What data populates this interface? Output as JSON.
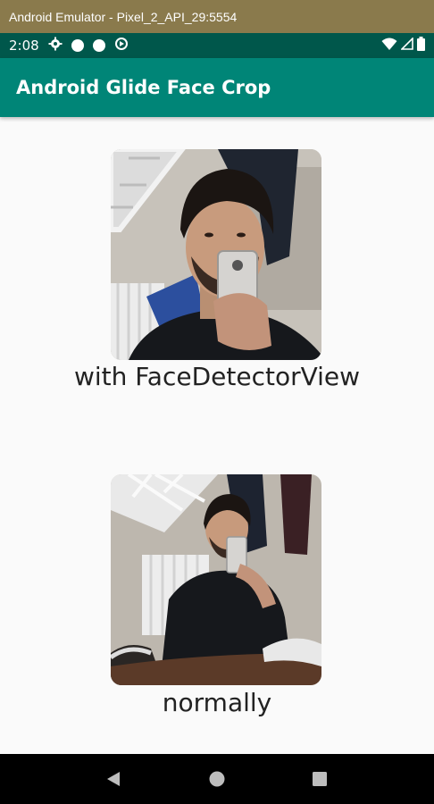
{
  "emulator": {
    "title": "Android Emulator - Pixel_2_API_29:5554"
  },
  "status_bar": {
    "time": "2:08",
    "left_icons": [
      "gear-icon",
      "circle-icon",
      "circle-icon",
      "data-saver-icon"
    ],
    "right_icons": [
      "wifi-icon",
      "signal-icon",
      "battery-icon"
    ]
  },
  "app_bar": {
    "title": "Android Glide Face Crop"
  },
  "items": [
    {
      "caption": "with FaceDetectorView",
      "image": "face-cropped-photo"
    },
    {
      "caption": "normally",
      "image": "full-photo"
    }
  ],
  "nav_bar": {
    "buttons": [
      "back-icon",
      "home-icon",
      "recents-icon"
    ]
  },
  "colors": {
    "emulator_titlebar": "#8a7a4c",
    "status_bar": "#00574b",
    "app_bar": "#008577",
    "background": "#fafafa",
    "nav_bar": "#000000"
  }
}
